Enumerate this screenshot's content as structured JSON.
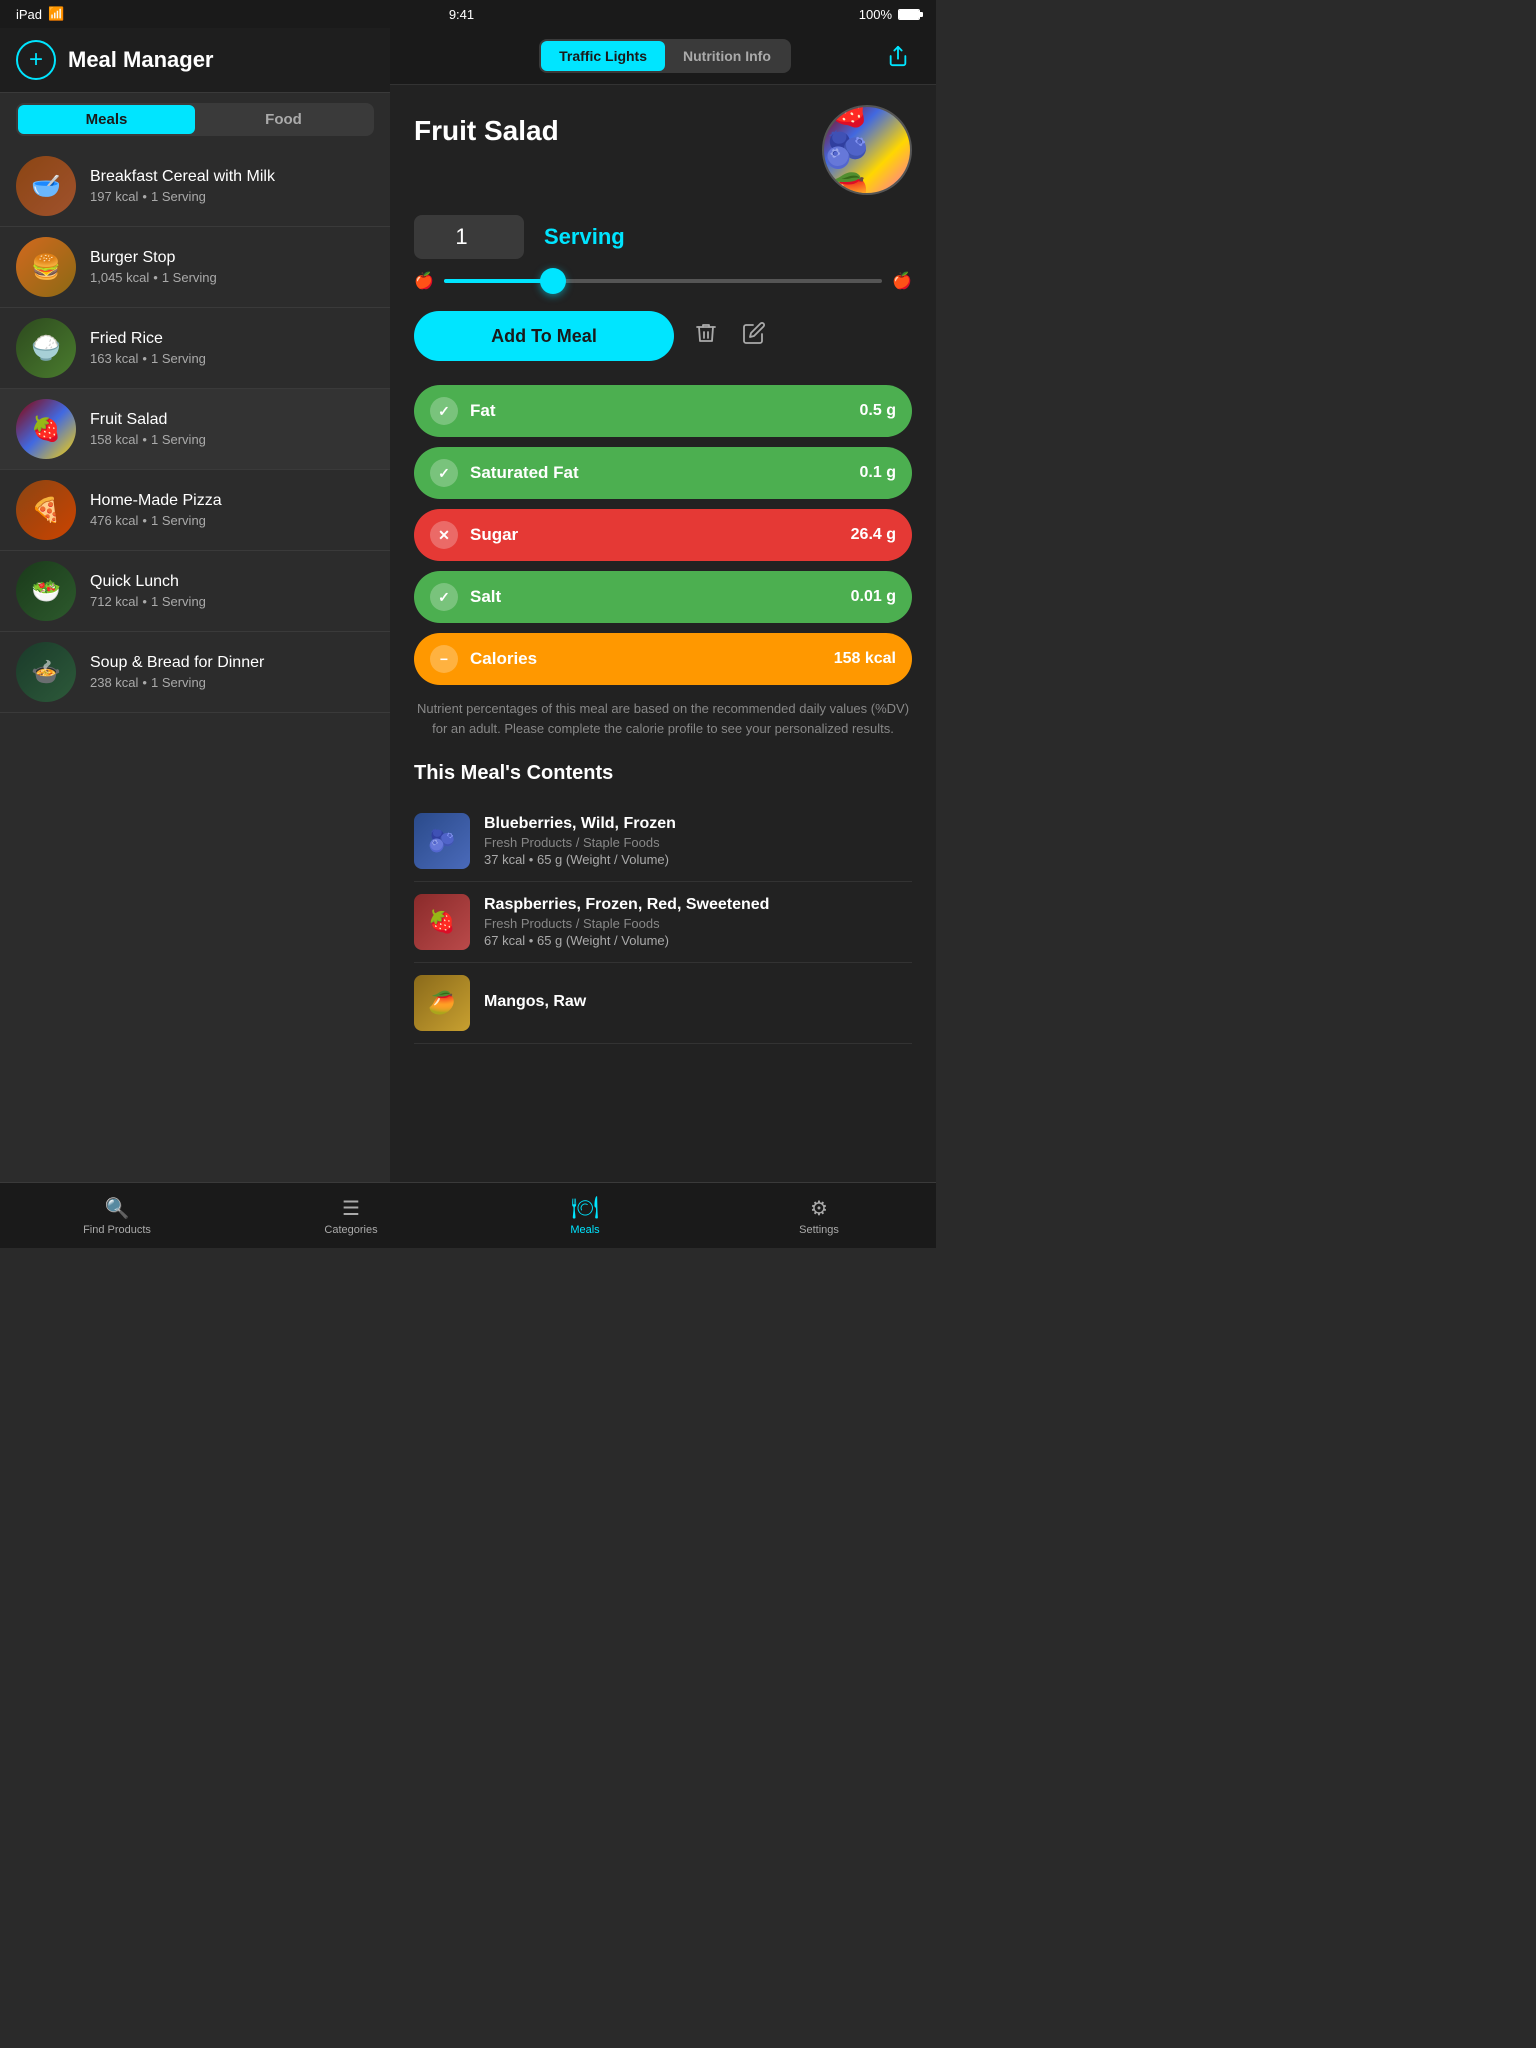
{
  "status": {
    "device": "iPad",
    "time": "9:41",
    "battery": "100%"
  },
  "sidebar": {
    "title": "Meal Manager",
    "add_label": "+",
    "tabs": [
      {
        "id": "meals",
        "label": "Meals",
        "active": true
      },
      {
        "id": "food",
        "label": "Food",
        "active": false
      }
    ],
    "meals": [
      {
        "name": "Breakfast Cereal with Milk",
        "kcal": "197 kcal",
        "serving": "1 Serving",
        "emoji": "🥣"
      },
      {
        "name": "Burger Stop",
        "kcal": "1,045 kcal",
        "serving": "1 Serving",
        "emoji": "🍔"
      },
      {
        "name": "Fried Rice",
        "kcal": "163 kcal",
        "serving": "1 Serving",
        "emoji": "🍚"
      },
      {
        "name": "Fruit Salad",
        "kcal": "158 kcal",
        "serving": "1 Serving",
        "emoji": "🍓",
        "selected": true
      },
      {
        "name": "Home-Made Pizza",
        "kcal": "476 kcal",
        "serving": "1 Serving",
        "emoji": "🍕"
      },
      {
        "name": "Quick Lunch",
        "kcal": "712 kcal",
        "serving": "1 Serving",
        "emoji": "🥗"
      },
      {
        "name": "Soup & Bread for Dinner",
        "kcal": "238 kcal",
        "serving": "1 Serving",
        "emoji": "🍲"
      }
    ]
  },
  "detail": {
    "food_name": "Fruit Salad",
    "right_tabs": [
      {
        "label": "Traffic Lights",
        "active": true
      },
      {
        "label": "Nutrition Info",
        "active": false
      }
    ],
    "serving_count": "1",
    "serving_label": "Serving",
    "add_meal_label": "Add To Meal",
    "nutrition": [
      {
        "name": "Fat",
        "value": "0.5 g",
        "status": "green",
        "icon": "✓"
      },
      {
        "name": "Saturated Fat",
        "value": "0.1 g",
        "status": "green",
        "icon": "✓"
      },
      {
        "name": "Sugar",
        "value": "26.4 g",
        "status": "red",
        "icon": "✕"
      },
      {
        "name": "Salt",
        "value": "0.01 g",
        "status": "green",
        "icon": "✓"
      },
      {
        "name": "Calories",
        "value": "158 kcal",
        "status": "orange",
        "icon": "−"
      }
    ],
    "disclaimer": "Nutrient percentages of this meal are based on the recommended daily values (%DV) for an adult. Please complete the calorie profile to see your personalized results.",
    "contents_title": "This Meal's Contents",
    "contents": [
      {
        "name": "Blueberries, Wild, Frozen",
        "category": "Fresh Products / Staple Foods",
        "meta": "37 kcal  •  65 g (Weight / Volume)",
        "emoji": "🫐"
      },
      {
        "name": "Raspberries, Frozen, Red, Sweetened",
        "category": "Fresh Products / Staple Foods",
        "meta": "67 kcal  •  65 g (Weight / Volume)",
        "emoji": "🍓"
      },
      {
        "name": "Mangos, Raw",
        "category": "",
        "meta": "",
        "emoji": "🥭"
      }
    ]
  },
  "bottom_nav": [
    {
      "id": "find",
      "label": "Find Products",
      "icon": "🔍",
      "active": false
    },
    {
      "id": "categories",
      "label": "Categories",
      "icon": "☰",
      "active": false
    },
    {
      "id": "meals",
      "label": "Meals",
      "icon": "🍽",
      "active": true
    },
    {
      "id": "settings",
      "label": "Settings",
      "icon": "⚙",
      "active": false
    }
  ]
}
